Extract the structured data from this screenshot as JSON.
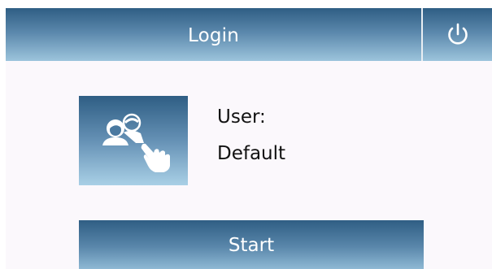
{
  "header": {
    "title": "Login",
    "power_icon": "power-icon"
  },
  "user": {
    "tile_icon": "user-switch-icon",
    "label": "User:",
    "name": "Default"
  },
  "actions": {
    "start_label": "Start"
  },
  "colors": {
    "bar_dark": "#2f5e84",
    "bar_light": "#9cc4dc",
    "background": "#fbf8fc",
    "text": "#111111"
  }
}
